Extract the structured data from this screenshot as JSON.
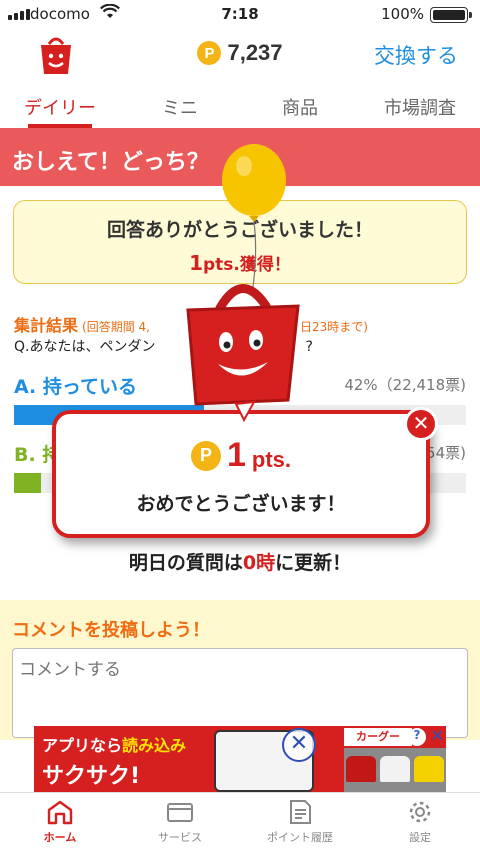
{
  "status_bar": {
    "carrier": "docomo",
    "time": "7:18",
    "battery": "100%"
  },
  "header": {
    "points": "7,237",
    "coin_symbol": "P",
    "exchange_label": "交換する"
  },
  "tabs": [
    {
      "label": "デイリー",
      "active": true
    },
    {
      "label": "ミニ",
      "active": false
    },
    {
      "label": "商品",
      "active": false
    },
    {
      "label": "市場調査",
      "active": false
    }
  ],
  "banner": {
    "title": "おしえて！どっち？"
  },
  "thanks": {
    "message": "回答ありがとうございました！",
    "earned_num": "1",
    "earned_unit": "pts.獲得！"
  },
  "results": {
    "title": "集計結果",
    "period_left": "(回答期間 4,",
    "period_right": "日23時まで)",
    "question_left": "Q.あなたは、ペンダン",
    "question_right": "?",
    "answers": [
      {
        "label": "A. 持っている",
        "pct_text": "42%（22,418票)",
        "fraction": 0.42
      },
      {
        "label": "B. 持",
        "pct_text": "54票)",
        "fraction": 0.06
      }
    ]
  },
  "next_update": {
    "prefix": "明日の質問は",
    "highlight": "0時",
    "suffix": "に更新！"
  },
  "comment": {
    "title": "コメントを投稿しよう！",
    "placeholder": "コメントする"
  },
  "ad": {
    "line1_a": "アプリなら",
    "line1_b": "読み込み",
    "line2": "サクサク!",
    "brand": "カーグー",
    "help": "?",
    "close": "✕"
  },
  "popup": {
    "coin_symbol": "P",
    "points_num": "1",
    "points_unit": "pts.",
    "message": "おめでとうございます！",
    "close": "✕"
  },
  "tabbar": [
    {
      "label": "ホーム",
      "icon": "home-icon",
      "active": true
    },
    {
      "label": "サービス",
      "icon": "card-icon",
      "active": false
    },
    {
      "label": "ポイント履歴",
      "icon": "document-icon",
      "active": false
    },
    {
      "label": "設定",
      "icon": "gear-icon",
      "active": false
    }
  ],
  "colors": {
    "brand_red": "#d6201f",
    "banner": "#ea5a5a",
    "blue": "#1e8fe0",
    "green": "#7fb324",
    "orange": "#ee6d12",
    "coin": "#f5b416"
  }
}
